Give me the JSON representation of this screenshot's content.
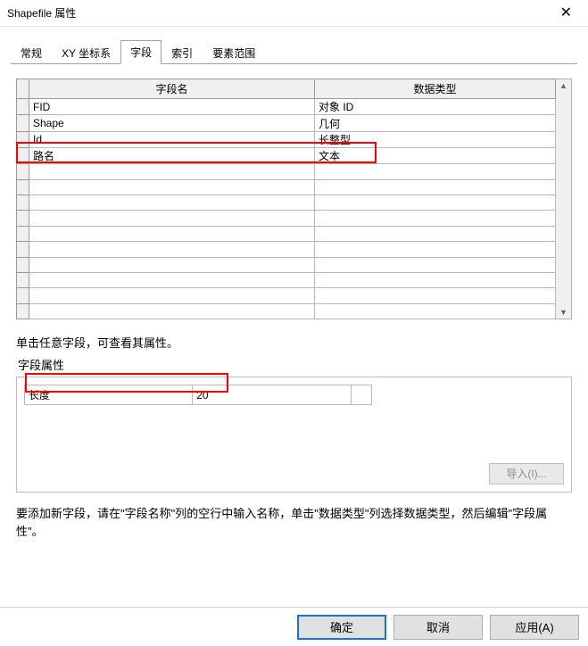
{
  "window": {
    "title": "Shapefile 属性",
    "close_glyph": "✕"
  },
  "tabs": [
    {
      "label": "常规"
    },
    {
      "label": "XY 坐标系"
    },
    {
      "label": "字段"
    },
    {
      "label": "索引"
    },
    {
      "label": "要素范围"
    }
  ],
  "active_tab_index": 2,
  "grid": {
    "columns": [
      "字段名",
      "数据类型"
    ],
    "rows": [
      {
        "name": "FID",
        "type": "对象 ID"
      },
      {
        "name": "Shape",
        "type": "几何"
      },
      {
        "name": "Id",
        "type": "长整型"
      },
      {
        "name": "路名",
        "type": "文本"
      },
      {
        "name": "",
        "type": ""
      },
      {
        "name": "",
        "type": ""
      },
      {
        "name": "",
        "type": ""
      },
      {
        "name": "",
        "type": ""
      },
      {
        "name": "",
        "type": ""
      },
      {
        "name": "",
        "type": ""
      },
      {
        "name": "",
        "type": ""
      },
      {
        "name": "",
        "type": ""
      },
      {
        "name": "",
        "type": ""
      },
      {
        "name": "",
        "type": ""
      }
    ]
  },
  "hint_text": "单击任意字段，可查看其属性。",
  "fieldset_label": "字段属性",
  "properties": [
    {
      "label": "长度",
      "value": "20"
    }
  ],
  "import_button": "导入(I)...",
  "help_text": "要添加新字段，请在\"字段名称\"列的空行中输入名称，单击\"数据类型\"列选择数据类型，然后编辑\"字段属性\"。",
  "footer": {
    "ok": "确定",
    "cancel": "取消",
    "apply": "应用(A)"
  }
}
